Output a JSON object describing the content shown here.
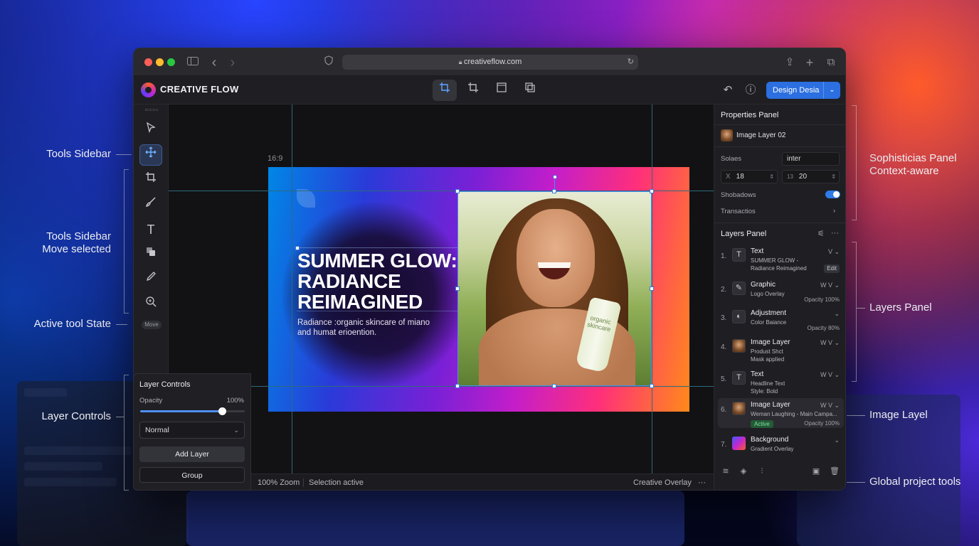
{
  "annotations": {
    "tools_sidebar": "Tools Sidebar",
    "tools_move_line1": "Tools Sidebar",
    "tools_move_line2": "Move selected",
    "active_tool": "Active tool State",
    "layer_controls": "Layer Controls",
    "panel_line1": "Sophisticias Panel",
    "panel_line2": "Context-aware",
    "layers_panel": "Layers Panel",
    "image_layer": "Image Layel",
    "global_tools": "Global project tools"
  },
  "browser": {
    "url": "creativeflow.com"
  },
  "app": {
    "name": "CREATIVE FLOW",
    "primary_button": "Design Desia",
    "move_badge": "Move"
  },
  "canvas": {
    "ratio": "16:9",
    "headline_1": "SUMMER GLOW:",
    "headline_2": "RADIANCE",
    "headline_3": "REIMAGINED",
    "sub_1": "Radiance :organic skincare of miano",
    "sub_2": "and humat erioention.",
    "tube_text": "organic skincare"
  },
  "status": {
    "zoom": "100% Zoom",
    "selection": "Selection active",
    "overlay": "Creative Overlay"
  },
  "layer_controls": {
    "title": "Layer Controls",
    "opacity_label": "Opacity",
    "opacity_value": "100%",
    "opacity_fraction": 0.78,
    "blend_mode": "Normal",
    "add_layer": "Add Layer",
    "group": "Group"
  },
  "properties": {
    "title": "Properties Panel",
    "layer": "Image Layer 02",
    "font_label": "Solaes",
    "font_value": "inter",
    "x_label": "X",
    "x_value": "18",
    "y_label": "13",
    "y_value": "20",
    "shadows_label": "Shobadows",
    "shadows_on": true,
    "transitions_label": "Transactios"
  },
  "layers": {
    "title": "Layers Panel",
    "items": [
      {
        "num": "1.",
        "name": "Text",
        "desc": "SUMMER GLOW -",
        "desc2": "Radiance Reimagined",
        "ctl": "V ⌄",
        "extra": "Edit",
        "icon": "T"
      },
      {
        "num": "2.",
        "name": "Graphic",
        "desc": "Logo Overlay",
        "ctl": "W V ⌄",
        "extra": "Opacity 100%",
        "icon": "✎"
      },
      {
        "num": "3.",
        "name": "Adjustment",
        "desc": "Color Baiance",
        "ctl": "⌄",
        "extra": "Opacity 80%",
        "icon": "◐"
      },
      {
        "num": "4.",
        "name": "Image Layer",
        "desc": "Produst Shct",
        "desc2": "Mask applied",
        "ctl": "W V ⌄",
        "extra": "",
        "icon": "img"
      },
      {
        "num": "5.",
        "name": "Text",
        "desc": "Headline Text",
        "desc2": "Style: Bold",
        "ctl": "W V ⌄",
        "extra": "",
        "icon": "T"
      },
      {
        "num": "6.",
        "name": "Image Layer",
        "desc": "Weman Laughing - Main Campa...",
        "badge": "Active",
        "ctl": "W V ⌄",
        "extra": "Opacity 100%",
        "icon": "img"
      },
      {
        "num": "7.",
        "name": "Background",
        "desc": "Gradient Overlay",
        "ctl": "⌄",
        "extra": "",
        "icon": "grad"
      }
    ]
  },
  "icons": {
    "back": "‹",
    "forward": "›",
    "share": "⇪",
    "plus": "+",
    "tabs": "⧉",
    "undo": "↶",
    "info": "ⓘ",
    "more": "···"
  }
}
